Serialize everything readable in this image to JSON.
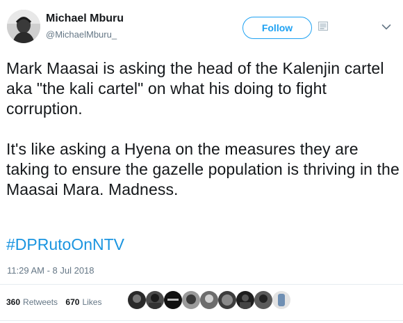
{
  "user": {
    "name": "Michael Mburu",
    "handle": "@MichaelMburu_"
  },
  "follow_label": "Follow",
  "tweet": {
    "paragraphs": [
      "Mark Maasai is asking the head of the Kalenjin cartel aka \"the kali cartel\" on what his doing to fight corruption.",
      "It's like asking a Hyena on the measures they are taking to ensure the gazelle population is thriving in the Maasai Mara. Madness."
    ],
    "hashtag": "#DPRutoOnNTV",
    "timestamp": "11:29 AM - 8 Jul 2018"
  },
  "stats": {
    "retweets_count": "360",
    "retweets_label": "Retweets",
    "likes_count": "670",
    "likes_label": "Likes"
  },
  "colors": {
    "accent": "#1da1f2",
    "hashtag": "#1b95e0",
    "muted": "#657786"
  },
  "icons": {
    "more": "chevron-down-icon",
    "card": "photo-card-icon"
  }
}
